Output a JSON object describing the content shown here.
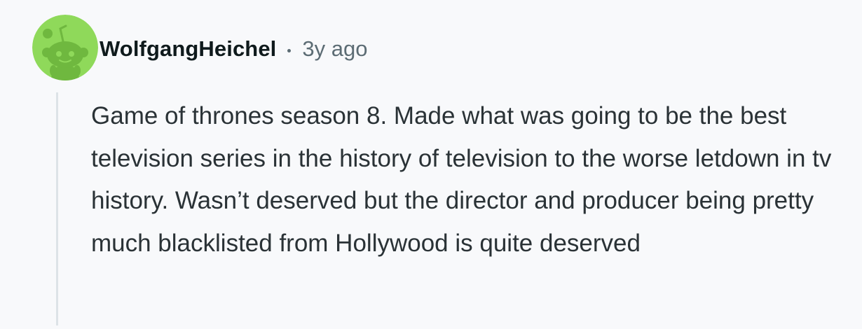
{
  "comment": {
    "author": "WolfgangHeichel",
    "separator": "•",
    "timestamp": "3y ago",
    "avatar_icon": "snoo-avatar-icon",
    "avatar_bg": "#8fd95a",
    "body": "Game of thrones season 8. Made what was going to be the best television series in the history of television to the worse letdown in tv history. Wasn’t deserved but the director and producer being pretty much blacklisted from Hollywood is quite deserved"
  }
}
